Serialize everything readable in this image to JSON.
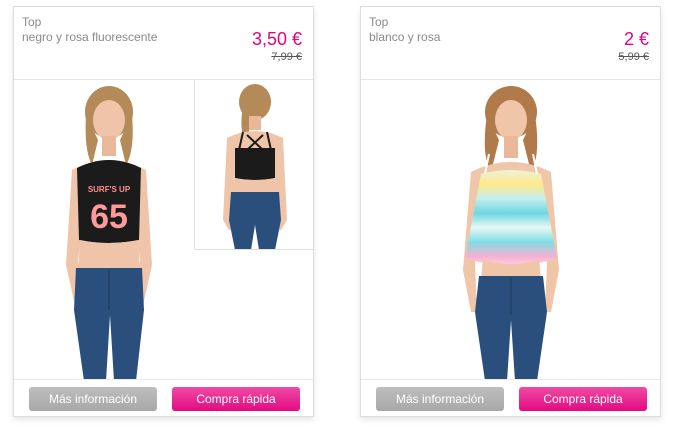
{
  "products": [
    {
      "category": "Top",
      "color": "negro y rosa fluorescente",
      "price": "3,50 €",
      "old_price": "7,99 €",
      "print_text": "SURF'S UP",
      "print_number": "65",
      "info_button": "Más información",
      "buy_button": "Compra rápida"
    },
    {
      "category": "Top",
      "color": "blanco y rosa",
      "price": "2 €",
      "old_price": "5,99 €",
      "info_button": "Más información",
      "buy_button": "Compra rápida"
    }
  ],
  "colors": {
    "accent": "#e6007e",
    "gray_button": "#b0b0b0"
  }
}
